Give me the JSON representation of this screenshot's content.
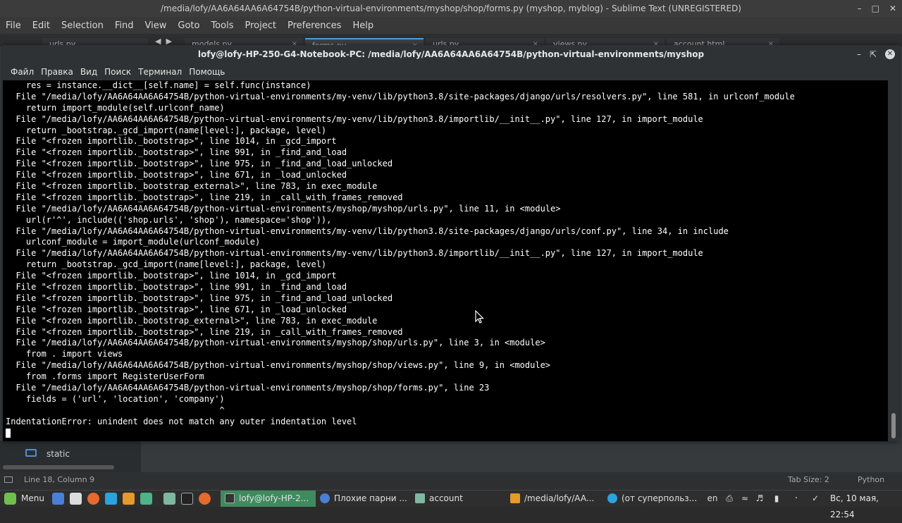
{
  "sublime": {
    "title": "/media/lofy/AA6A64AA6A64754B/python-virtual-environments/myshop/shop/forms.py (myshop, myblog) - Sublime Text (UNREGISTERED)",
    "menu": [
      "File",
      "Edit",
      "Selection",
      "Find",
      "View",
      "Goto",
      "Tools",
      "Project",
      "Preferences",
      "Help"
    ],
    "tabs": [
      "urls.py",
      "models.py",
      "forms.py",
      "urls.py",
      "views.py",
      "account.html"
    ],
    "sidebar_folder": "static",
    "status": {
      "position": "Line 18, Column 9",
      "tab_size": "Tab Size: 2",
      "syntax": "Python"
    }
  },
  "terminal": {
    "title": "lofy@lofy-HP-250-G4-Notebook-PC: /media/lofy/AA6A64AA6A64754B/python-virtual-environments/myshop",
    "menu": [
      "Файл",
      "Правка",
      "Вид",
      "Поиск",
      "Терминал",
      "Помощь"
    ],
    "lines": [
      "    res = instance.__dict__[self.name] = self.func(instance)",
      "  File \"/media/lofy/AA6A64AA6A64754B/python-virtual-environments/my-venv/lib/python3.8/site-packages/django/urls/resolvers.py\", line 581, in urlconf_module",
      "    return import_module(self.urlconf_name)",
      "  File \"/media/lofy/AA6A64AA6A64754B/python-virtual-environments/my-venv/lib/python3.8/importlib/__init__.py\", line 127, in import_module",
      "    return _bootstrap._gcd_import(name[level:], package, level)",
      "  File \"<frozen importlib._bootstrap>\", line 1014, in _gcd_import",
      "  File \"<frozen importlib._bootstrap>\", line 991, in _find_and_load",
      "  File \"<frozen importlib._bootstrap>\", line 975, in _find_and_load_unlocked",
      "  File \"<frozen importlib._bootstrap>\", line 671, in _load_unlocked",
      "  File \"<frozen importlib._bootstrap_external>\", line 783, in exec_module",
      "  File \"<frozen importlib._bootstrap>\", line 219, in _call_with_frames_removed",
      "  File \"/media/lofy/AA6A64AA6A64754B/python-virtual-environments/myshop/myshop/urls.py\", line 11, in <module>",
      "    url(r'^', include(('shop.urls', 'shop'), namespace='shop')),",
      "  File \"/media/lofy/AA6A64AA6A64754B/python-virtual-environments/my-venv/lib/python3.8/site-packages/django/urls/conf.py\", line 34, in include",
      "    urlconf_module = import_module(urlconf_module)",
      "  File \"/media/lofy/AA6A64AA6A64754B/python-virtual-environments/my-venv/lib/python3.8/importlib/__init__.py\", line 127, in import_module",
      "    return _bootstrap._gcd_import(name[level:], package, level)",
      "  File \"<frozen importlib._bootstrap>\", line 1014, in _gcd_import",
      "  File \"<frozen importlib._bootstrap>\", line 991, in _find_and_load",
      "  File \"<frozen importlib._bootstrap>\", line 975, in _find_and_load_unlocked",
      "  File \"<frozen importlib._bootstrap>\", line 671, in _load_unlocked",
      "  File \"<frozen importlib._bootstrap_external>\", line 783, in exec_module",
      "  File \"<frozen importlib._bootstrap>\", line 219, in _call_with_frames_removed",
      "  File \"/media/lofy/AA6A64AA6A64754B/python-virtual-environments/myshop/shop/urls.py\", line 3, in <module>",
      "    from . import views",
      "  File \"/media/lofy/AA6A64AA6A64754B/python-virtual-environments/myshop/shop/views.py\", line 9, in <module>",
      "    from .forms import RegisterUserForm",
      "  File \"/media/lofy/AA6A64AA6A64754B/python-virtual-environments/myshop/shop/forms.py\", line 23",
      "    fields = ('url', 'location', 'company')",
      "                                          ^",
      "IndentationError: unindent does not match any outer indentation level"
    ]
  },
  "taskbar": {
    "menu_label": "Menu",
    "windows": [
      {
        "label": "lofy@lofy-HP-2...",
        "color": "#333333"
      },
      {
        "label": "Плохие парни ...",
        "color": "#4a7fd6"
      },
      {
        "label": "account",
        "color": "#7fb8a0"
      },
      {
        "label": "/media/lofy/AA...",
        "color": "#e59a2b"
      },
      {
        "label": "(от суперпольз...",
        "color": "#2aa3e0"
      }
    ],
    "keyboard_layout": "en",
    "clock": "Вс, 10 мая, 22:54"
  },
  "colors": {
    "taskbar_active": "#3f8a5f",
    "terminal_bg": "#000000",
    "terminal_fg": "#ffffff"
  }
}
